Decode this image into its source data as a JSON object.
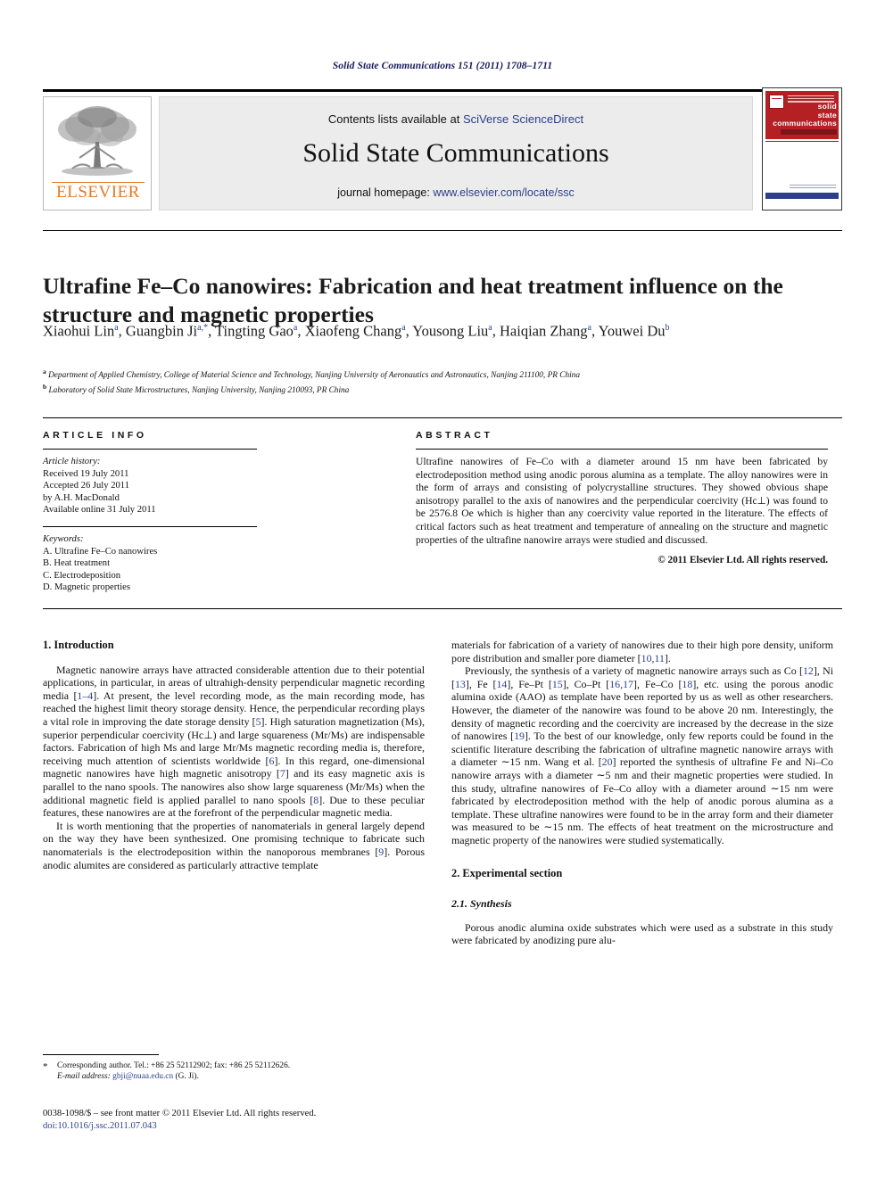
{
  "running_head": "Solid State Communications 151 (2011) 1708–1711",
  "masthead": {
    "contents_prefix": "Contents lists available at ",
    "sciencedirect_link": "SciVerse ScienceDirect",
    "journal_title": "Solid State Communications",
    "homepage_prefix": "journal homepage: ",
    "homepage_url": "www.elsevier.com/locate/ssc",
    "publisher_logo_text": "ELSEVIER",
    "cover_title_lines": [
      "solid",
      "state",
      "communications"
    ]
  },
  "article": {
    "title": "Ultrafine Fe–Co nanowires: Fabrication and heat treatment influence on the structure and magnetic properties",
    "authors_html": "Xiaohui Lin<sup>a</sup>, Guangbin Ji<sup>a,*</sup>, Tingting Gao<sup>a</sup>, Xiaofeng Chang<sup>a</sup>, Yousong Liu<sup>a</sup>, Haiqian Zhang<sup>a</sup>, Youwei Du<sup>b</sup>",
    "affiliation_a": "Department of Applied Chemistry, College of Material Science and Technology, Nanjing University of Aeronautics and Astronautics, Nanjing 211100, PR China",
    "affiliation_b": "Laboratory of Solid State Microstructures, Nanjing University, Nanjing 210093, PR China"
  },
  "article_info": {
    "heading": "ARTICLE INFO",
    "history_label": "Article history:",
    "received": "Received 19 July 2011",
    "accepted": "Accepted 26 July 2011",
    "by_editor": "by A.H. MacDonald",
    "available_online": "Available online 31 July 2011",
    "keywords_label": "Keywords:",
    "keywords": [
      "A. Ultrafine Fe–Co nanowires",
      "B. Heat treatment",
      "C. Electrodeposition",
      "D. Magnetic properties"
    ]
  },
  "abstract": {
    "heading": "ABSTRACT",
    "text": "Ultrafine nanowires of Fe–Co with a diameter around 15 nm have been fabricated by electrodeposition method using anodic porous alumina as a template. The alloy nanowires were in the form of arrays and consisting of polycrystalline structures. They showed obvious shape anisotropy parallel to the axis of nanowires and the perpendicular coercivity (Hc⊥) was found to be 2576.8 Oe which is higher than any coercivity value reported in the literature. The effects of critical factors such as heat treatment and temperature of annealing on the structure and magnetic properties of the ultrafine nanowire arrays were studied and discussed.",
    "copyright": "© 2011 Elsevier Ltd. All rights reserved."
  },
  "body": {
    "intro_heading": "1. Introduction",
    "intro_p1_html": "Magnetic nanowire arrays have attracted considerable attention due to their potential applications, in particular, in areas of ultrahigh-density perpendicular magnetic recording media [<span class=\"ref\">1–4</span>]. At present, the level recording mode, as the main recording mode, has reached the highest limit theory storage density. Hence, the perpendicular recording plays a vital role in improving the date storage density [<span class=\"ref\">5</span>]. High saturation magnetization (Ms), superior perpendicular coercivity (Hc⊥) and large squareness (Mr/Ms) are indispensable factors. Fabrication of high Ms and large Mr/Ms magnetic recording media is, therefore, receiving much attention of scientists worldwide [<span class=\"ref\">6</span>]. In this regard, one-dimensional magnetic nanowires have high magnetic anisotropy [<span class=\"ref\">7</span>] and its easy magnetic axis is parallel to the nano spools. The nanowires also show large squareness (Mr/Ms) when the additional magnetic field is applied parallel to nano spools [<span class=\"ref\">8</span>]. Due to these peculiar features, these nanowires are at the forefront of the perpendicular magnetic media.",
    "intro_p2_html": "It is worth mentioning that the properties of nanomaterials in general largely depend on the way they have been synthesized. One promising technique to fabricate such nanomaterials is the electrodeposition within the nanoporous membranes [<span class=\"ref\">9</span>]. Porous anodic alumites are considered as particularly attractive template",
    "intro_p2_cont_html": "materials for fabrication of a variety of nanowires due to their high pore density, uniform pore distribution and smaller pore diameter [<span class=\"ref\">10,11</span>].",
    "intro_p3_html": "Previously, the synthesis of a variety of magnetic nanowire arrays such as Co [<span class=\"ref\">12</span>], Ni [<span class=\"ref\">13</span>], Fe [<span class=\"ref\">14</span>], Fe–Pt [<span class=\"ref\">15</span>], Co–Pt [<span class=\"ref\">16,17</span>], Fe–Co [<span class=\"ref\">18</span>], etc. using the porous anodic alumina oxide (AAO) as template have been reported by us as well as other researchers. However, the diameter of the nanowire was found to be above 20 nm. Interestingly, the density of magnetic recording and the coercivity are increased by the decrease in the size of nanowires [<span class=\"ref\">19</span>]. To the best of our knowledge, only few reports could be found in the scientific literature describing the fabrication of ultrafine magnetic nanowire arrays with a diameter ∼15 nm. Wang et al. [<span class=\"ref\">20</span>] reported the synthesis of ultrafine Fe and Ni–Co nanowire arrays with a diameter ∼5 nm and their magnetic properties were studied. In this study, ultrafine nanowires of Fe–Co alloy with a diameter around ∼15 nm were fabricated by electrodeposition method with the help of anodic porous alumina as a template. These ultrafine nanowires were found to be in the array form and their diameter was measured to be ∼15 nm. The effects of heat treatment on the microstructure and magnetic property of the nanowires were studied systematically.",
    "experimental_heading": "2. Experimental section",
    "synthesis_heading": "2.1. Synthesis",
    "synthesis_p1": "Porous anodic alumina oxide substrates which were used as a substrate in this study were fabricated by anodizing pure alu-"
  },
  "footnote": {
    "marker": "*",
    "corresponding": "Corresponding author. Tel.: +86 25 52112902; fax: +86 25 52112626.",
    "email_label": "E-mail address:",
    "email": "gbji@nuaa.edu.cn",
    "email_suffix": "(G. Ji)."
  },
  "footer": {
    "front_matter": "0038-1098/$ – see front matter © 2011 Elsevier Ltd. All rights reserved.",
    "doi": "doi:10.1016/j.ssc.2011.07.043"
  },
  "colors": {
    "link_blue": "#2b3f8c",
    "elsevier_orange": "#E87722",
    "cover_red": "#b52025",
    "header_navy": "#1a1a5e"
  }
}
